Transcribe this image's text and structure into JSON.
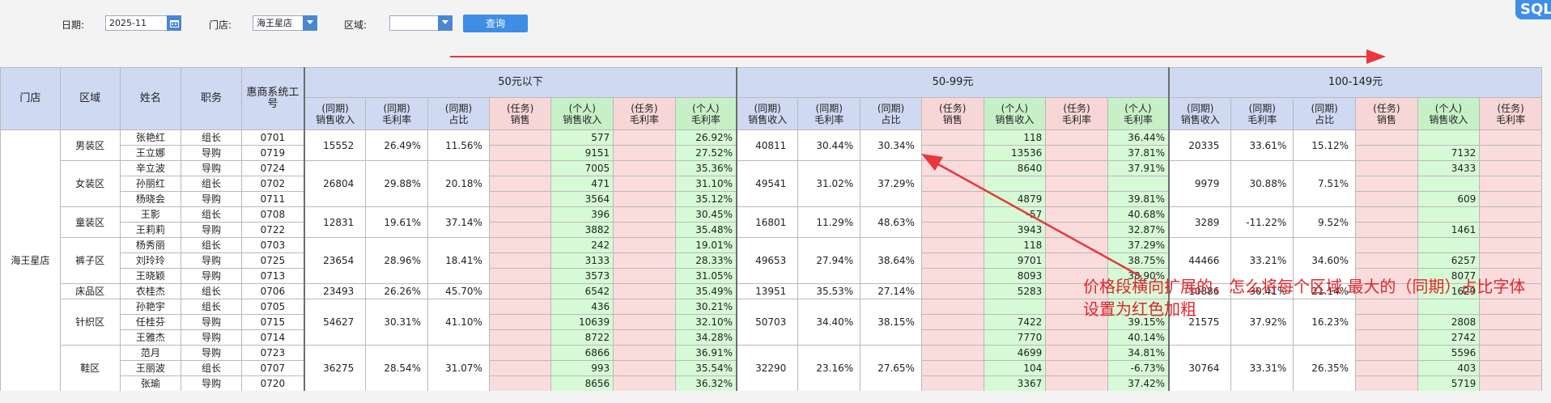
{
  "filters": {
    "date_label": "日期:",
    "date_value": "2025-11",
    "store_label": "门店:",
    "store_value": "海王星店",
    "region_label": "区域:",
    "region_value": "",
    "query_label": "查询"
  },
  "corner_badge": "SQL",
  "header": {
    "fixed": [
      "门店",
      "区域",
      "姓名",
      "职务",
      "惠商系统工号"
    ],
    "groups": [
      "50元以下",
      "50-99元",
      "100-149元"
    ],
    "metrics": [
      "(同期)销售收入",
      "(同期)毛利率",
      "(同期)占比",
      "(任务)销售",
      "(个人)销售收入",
      "(任务)毛利率",
      "(个人)毛利率"
    ],
    "metrics_last": [
      "(同期)销售收入",
      "(同期)毛利率",
      "(同期)占比",
      "(任务)销售",
      "(个人)销售收入",
      "(任务)毛利率"
    ]
  },
  "colors": {
    "header_blue": "#cfd9f2",
    "pink": "#fbdcdc",
    "green": "#d6fad6",
    "annotation_red": "#e0262c",
    "button_blue": "#3e8ee6"
  },
  "store": "海王星店",
  "regions": [
    {
      "name": "男装区",
      "g1": [
        "15552",
        "26.49%",
        "11.56%"
      ],
      "g2": [
        "40811",
        "30.44%",
        "30.34%"
      ],
      "g3": [
        "20335",
        "33.61%",
        "15.12%"
      ],
      "staff": [
        {
          "name": "张艳红",
          "role": "组长",
          "id": "0701",
          "a_rev": "577",
          "a_gm": "26.92%",
          "b_rev": "118",
          "b_gm": "36.44%",
          "c_rev": ""
        },
        {
          "name": "王立娜",
          "role": "导购",
          "id": "0719",
          "a_rev": "9151",
          "a_gm": "27.52%",
          "b_rev": "13536",
          "b_gm": "37.81%",
          "c_rev": "7132"
        }
      ]
    },
    {
      "name": "女装区",
      "g1": [
        "26804",
        "29.88%",
        "20.18%"
      ],
      "g2": [
        "49541",
        "31.02%",
        "37.29%"
      ],
      "g3": [
        "9979",
        "30.88%",
        "7.51%"
      ],
      "staff": [
        {
          "name": "辛立波",
          "role": "导购",
          "id": "0724",
          "a_rev": "7005",
          "a_gm": "35.36%",
          "b_rev": "8640",
          "b_gm": "37.91%",
          "c_rev": "3433"
        },
        {
          "name": "孙丽红",
          "role": "组长",
          "id": "0702",
          "a_rev": "471",
          "a_gm": "31.10%",
          "b_rev": "",
          "b_gm": "",
          "c_rev": ""
        },
        {
          "name": "杨晓会",
          "role": "导购",
          "id": "0711",
          "a_rev": "3564",
          "a_gm": "35.12%",
          "b_rev": "4879",
          "b_gm": "39.81%",
          "c_rev": "609"
        }
      ]
    },
    {
      "name": "童装区",
      "g1": [
        "12831",
        "19.61%",
        "37.14%"
      ],
      "g2": [
        "16801",
        "11.29%",
        "48.63%"
      ],
      "g3": [
        "3289",
        "-11.22%",
        "9.52%"
      ],
      "staff": [
        {
          "name": "王影",
          "role": "组长",
          "id": "0708",
          "a_rev": "396",
          "a_gm": "30.45%",
          "b_rev": "-57",
          "b_gm": "40.68%",
          "c_rev": ""
        },
        {
          "name": "王莉莉",
          "role": "导购",
          "id": "0722",
          "a_rev": "3882",
          "a_gm": "35.48%",
          "b_rev": "3943",
          "b_gm": "32.87%",
          "c_rev": "1461"
        }
      ]
    },
    {
      "name": "裤子区",
      "g1": [
        "23654",
        "28.96%",
        "18.41%"
      ],
      "g2": [
        "49653",
        "27.94%",
        "38.64%"
      ],
      "g3": [
        "44466",
        "33.21%",
        "34.60%"
      ],
      "staff": [
        {
          "name": "杨秀丽",
          "role": "组长",
          "id": "0703",
          "a_rev": "242",
          "a_gm": "19.01%",
          "b_rev": "118",
          "b_gm": "37.29%",
          "c_rev": ""
        },
        {
          "name": "刘玲玲",
          "role": "导购",
          "id": "0725",
          "a_rev": "3133",
          "a_gm": "28.33%",
          "b_rev": "9701",
          "b_gm": "38.75%",
          "c_rev": "6257"
        },
        {
          "name": "王晓颖",
          "role": "导购",
          "id": "0713",
          "a_rev": "3573",
          "a_gm": "31.05%",
          "b_rev": "8093",
          "b_gm": "38.90%",
          "c_rev": "8077"
        }
      ]
    },
    {
      "name": "床品区",
      "g1": [
        "23493",
        "26.26%",
        "45.70%"
      ],
      "g2": [
        "13951",
        "35.53%",
        "27.14%"
      ],
      "g3": [
        "10886",
        "30.41%",
        "21.14%"
      ],
      "staff": [
        {
          "name": "衣桂杰",
          "role": "组长",
          "id": "0706",
          "a_rev": "6542",
          "a_gm": "35.49%",
          "b_rev": "5283",
          "b_gm": "",
          "c_rev": "1629"
        }
      ]
    },
    {
      "name": "针织区",
      "g1": [
        "54627",
        "30.31%",
        "41.10%"
      ],
      "g2": [
        "50703",
        "34.40%",
        "38.15%"
      ],
      "g3": [
        "21575",
        "37.92%",
        "16.23%"
      ],
      "staff": [
        {
          "name": "孙艳宇",
          "role": "组长",
          "id": "0705",
          "a_rev": "436",
          "a_gm": "30.21%",
          "b_rev": "",
          "b_gm": "",
          "c_rev": ""
        },
        {
          "name": "任桂芬",
          "role": "导购",
          "id": "0715",
          "a_rev": "10639",
          "a_gm": "32.10%",
          "b_rev": "7422",
          "b_gm": "39.15%",
          "c_rev": "2808"
        },
        {
          "name": "王雅杰",
          "role": "导购",
          "id": "0714",
          "a_rev": "8722",
          "a_gm": "34.28%",
          "b_rev": "7770",
          "b_gm": "40.14%",
          "c_rev": "2742"
        }
      ]
    },
    {
      "name": "鞋区",
      "g1": [
        "36275",
        "28.54%",
        "31.07%"
      ],
      "g2": [
        "32290",
        "23.16%",
        "27.65%"
      ],
      "g3": [
        "30764",
        "33.31%",
        "26.35%"
      ],
      "staff": [
        {
          "name": "范月",
          "role": "导购",
          "id": "0723",
          "a_rev": "6866",
          "a_gm": "36.91%",
          "b_rev": "4699",
          "b_gm": "34.81%",
          "c_rev": "5596"
        },
        {
          "name": "王丽波",
          "role": "组长",
          "id": "0707",
          "a_rev": "993",
          "a_gm": "35.54%",
          "b_rev": "104",
          "b_gm": "-6.73%",
          "c_rev": "403"
        },
        {
          "name": "张瑜",
          "role": "导购",
          "id": "0720",
          "a_rev": "8656",
          "a_gm": "36.32%",
          "b_rev": "3367",
          "b_gm": "37.42%",
          "c_rev": "5719"
        }
      ]
    }
  ],
  "annotation": {
    "text": "价格段横向扩展的，怎么将每个区域 最大的（同期）占比字体设置为红色加粗"
  }
}
